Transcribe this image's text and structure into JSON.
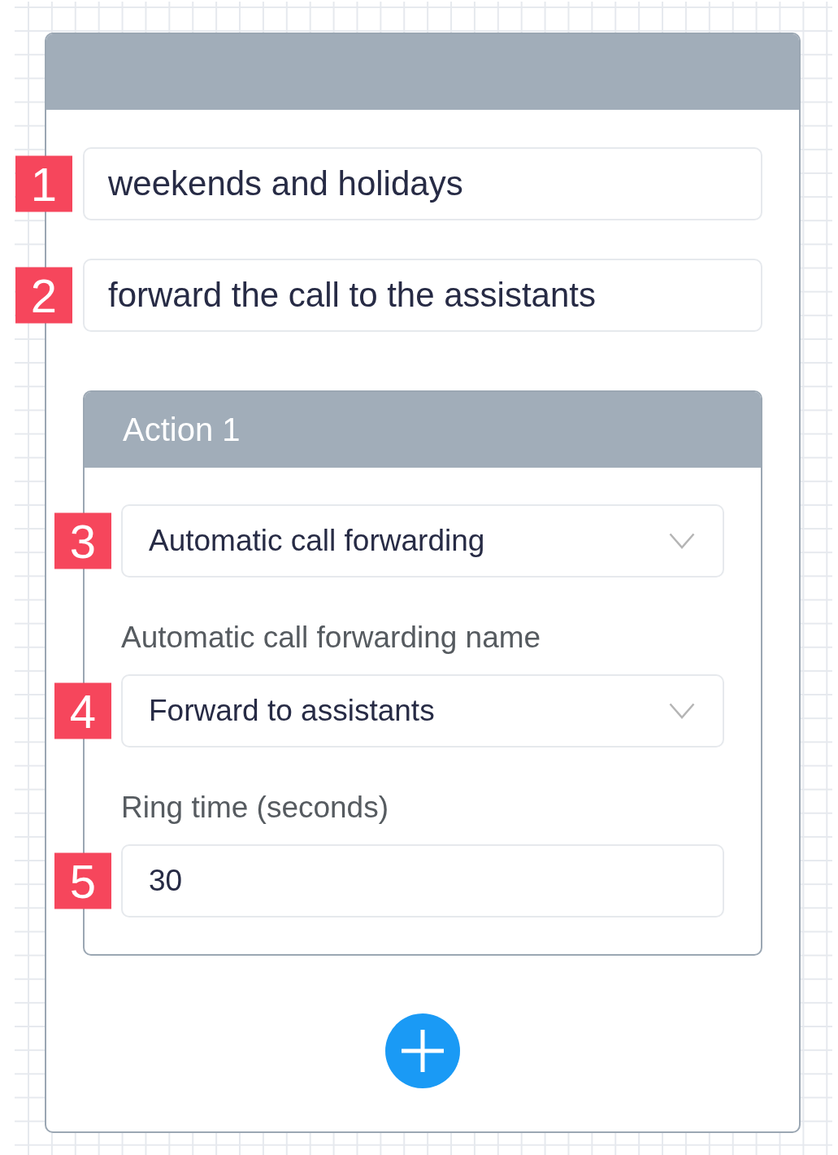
{
  "card": {
    "fields": [
      {
        "marker": "1",
        "value": "weekends and holidays"
      },
      {
        "marker": "2",
        "value": "forward the call to the assistants"
      }
    ],
    "action": {
      "title": "Action 1",
      "fields": [
        {
          "kind": "select",
          "marker": "3",
          "value": "Automatic call forwarding"
        },
        {
          "kind": "select",
          "marker": "4",
          "label": "Automatic call forwarding name",
          "value": "Forward to assistants"
        },
        {
          "kind": "input",
          "marker": "5",
          "label": "Ring time (seconds)",
          "value": "30"
        }
      ]
    }
  }
}
